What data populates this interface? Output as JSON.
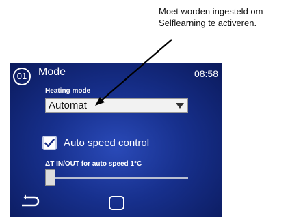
{
  "annotation": {
    "line1": "Moet worden ingesteld om",
    "line2": "Selflearning te activeren."
  },
  "header": {
    "page_number": "01",
    "title": "Mode",
    "time": "08:58"
  },
  "heating_mode": {
    "label": "Heating mode",
    "value": "Automat"
  },
  "auto_speed": {
    "checkbox_label": "Auto speed control",
    "checked": true
  },
  "delta_t": {
    "label": "ΔT IN/OUT for auto speed  1°C",
    "slider_value_fraction": 0
  },
  "navigation": {
    "back_icon": "return-arrow-icon",
    "home_icon": "square-home-icon"
  },
  "colors": {
    "screen_background": "#17308d",
    "text": "#ffffff"
  }
}
